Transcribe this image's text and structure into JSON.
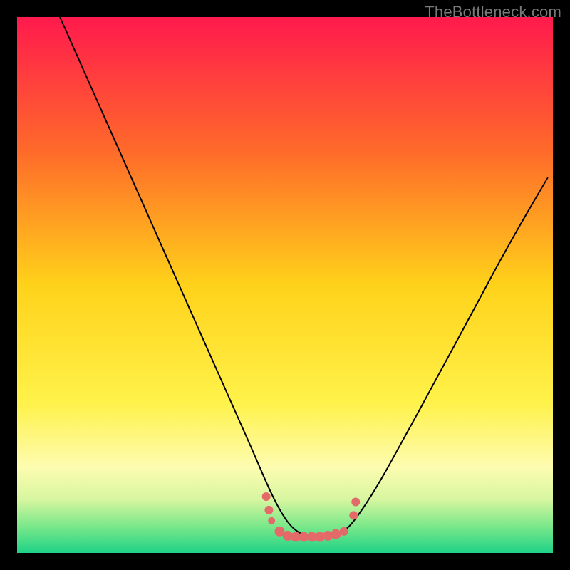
{
  "watermark": "TheBottleneck.com",
  "chart_data": {
    "type": "line",
    "title": "",
    "xlabel": "",
    "ylabel": "",
    "xlim": [
      0,
      100
    ],
    "ylim": [
      0,
      100
    ],
    "background_gradient": {
      "stops": [
        {
          "offset": 0.0,
          "color": "#ff1a4d"
        },
        {
          "offset": 0.25,
          "color": "#ff6a2a"
        },
        {
          "offset": 0.5,
          "color": "#ffd21a"
        },
        {
          "offset": 0.72,
          "color": "#fff24a"
        },
        {
          "offset": 0.84,
          "color": "#fdfcb0"
        },
        {
          "offset": 0.9,
          "color": "#d7f6a0"
        },
        {
          "offset": 0.95,
          "color": "#7be88a"
        },
        {
          "offset": 1.0,
          "color": "#1fd287"
        }
      ]
    },
    "series": [
      {
        "name": "bottleneck-curve",
        "color": "#000000",
        "stroke_width": 2,
        "x": [
          8,
          12,
          16,
          20,
          24,
          28,
          32,
          36,
          40,
          44,
          47,
          49,
          51,
          53,
          55,
          57,
          59,
          61,
          63,
          67,
          72,
          78,
          85,
          92,
          99
        ],
        "y": [
          100,
          91,
          82,
          73,
          64,
          55,
          46,
          37,
          28,
          19,
          12,
          8,
          5,
          3.5,
          3,
          3,
          3.3,
          4,
          6,
          12,
          21,
          32,
          45,
          58,
          70
        ]
      }
    ],
    "scatter": {
      "name": "valley-dots",
      "color": "#e46a6a",
      "points": [
        {
          "x": 46.5,
          "y": 10.5,
          "r": 6
        },
        {
          "x": 47.0,
          "y": 8.0,
          "r": 6
        },
        {
          "x": 47.5,
          "y": 6.0,
          "r": 5
        },
        {
          "x": 49.0,
          "y": 4.0,
          "r": 7
        },
        {
          "x": 50.5,
          "y": 3.2,
          "r": 7
        },
        {
          "x": 52.0,
          "y": 3.0,
          "r": 7
        },
        {
          "x": 53.5,
          "y": 3.0,
          "r": 7
        },
        {
          "x": 55.0,
          "y": 3.0,
          "r": 7
        },
        {
          "x": 56.5,
          "y": 3.0,
          "r": 7
        },
        {
          "x": 58.0,
          "y": 3.2,
          "r": 7
        },
        {
          "x": 59.5,
          "y": 3.5,
          "r": 7
        },
        {
          "x": 61.0,
          "y": 4.0,
          "r": 6
        },
        {
          "x": 62.8,
          "y": 7.0,
          "r": 6
        },
        {
          "x": 63.2,
          "y": 9.5,
          "r": 6
        }
      ]
    }
  }
}
